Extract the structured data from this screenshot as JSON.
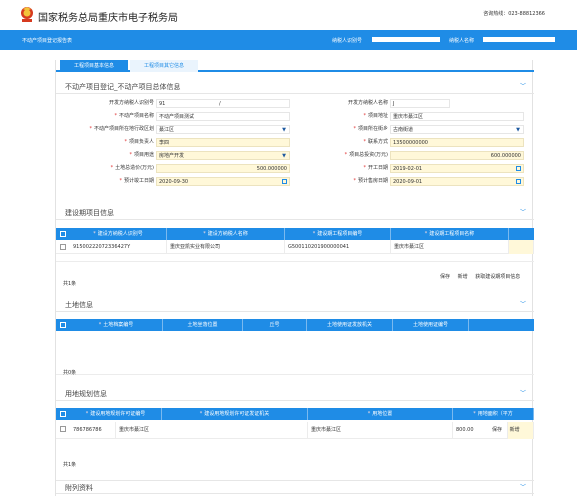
{
  "header": {
    "site_title": "国家税务总局重庆市电子税务局",
    "hotline": "咨询热线：023-88812366"
  },
  "navbar": {
    "page_title": "不动产项目登记报告表",
    "taxpayer_id_label": "纳税人识别号",
    "taxpayer_name_label": "纳税人名称"
  },
  "tabs": [
    "工程项目基本信息",
    "工程项目其它信息"
  ],
  "sections": {
    "overall": "不动产项目登记_不动产项目总体信息",
    "construction": "建设期项目信息",
    "land": "土地信息",
    "planning": "用地规划信息",
    "attachments": "附列资料"
  },
  "form": {
    "developer_id_label": "开发方纳税人识别号",
    "developer_id_value": "91",
    "developer_id_suffix": "/",
    "developer_name_label": "开发方纳税人名称",
    "developer_name_value": "J",
    "project_name_label": "不动产项目名称",
    "project_name_value": "不动产项目测试",
    "project_address_label": "项目地址",
    "project_address_value": "重庆市綦江区",
    "district_label": "不动产项目所在地行政区划",
    "district_value": "綦江区",
    "street_label": "项目所在街乡",
    "street_value": "古南街道",
    "manager_label": "项目负责人",
    "manager_value": "李四",
    "contact_label": "联系方式",
    "contact_value": "13500000000",
    "purpose_label": "项目用途",
    "purpose_value": "房地产开发",
    "total_investment_label": "项目总投资(万元)",
    "total_investment_value": "600.000000",
    "land_price_label": "土地总造价(万元)",
    "land_price_value": "500.000000",
    "start_date_label": "开工日期",
    "start_date_value": "2019-02-01",
    "completion_date_label": "预计竣工日期",
    "completion_date_value": "2020-09-30",
    "presale_date_label": "预计售房日期",
    "presale_date_value": "2020-09-01"
  },
  "construction_table": {
    "headers": [
      "建设方纳税人识别号",
      "建设方纳税人名称",
      "建设期工程项目编号",
      "建设期工程项目名称"
    ],
    "rows": [
      [
        "91500222072336427Y",
        "重庆亚凯实业有限公司",
        "G500110201900000041",
        "重庆市綦江区"
      ]
    ],
    "count": "共1条",
    "actions": [
      "保存",
      "新增",
      "获取建设期项目信息"
    ]
  },
  "land_table": {
    "headers": [
      "土地档案编号",
      "土地坐落位置",
      "丘号",
      "土地使用证发放机关",
      "土地使用证编号"
    ],
    "rows": [],
    "count": "共0条"
  },
  "planning_table": {
    "headers": [
      "建设用地规划许可证编号",
      "建设用地规划许可证发证机关",
      "用地位置",
      "用地面积（平方"
    ],
    "rows": [
      [
        "786786786",
        "重庆市綦江区",
        "重庆市綦江区",
        "800.00"
      ]
    ],
    "count": "共1条",
    "actions": [
      "保存",
      "新增"
    ]
  },
  "colors": {
    "primary": "#1f8ce6",
    "required": "#e03030",
    "readonly_field": "#fff8d9"
  },
  "icons": {
    "emblem": "national-emblem-icon",
    "collapse": "chevron-down-icon",
    "calendar": "calendar-icon",
    "dropdown": "caret-down-icon"
  }
}
